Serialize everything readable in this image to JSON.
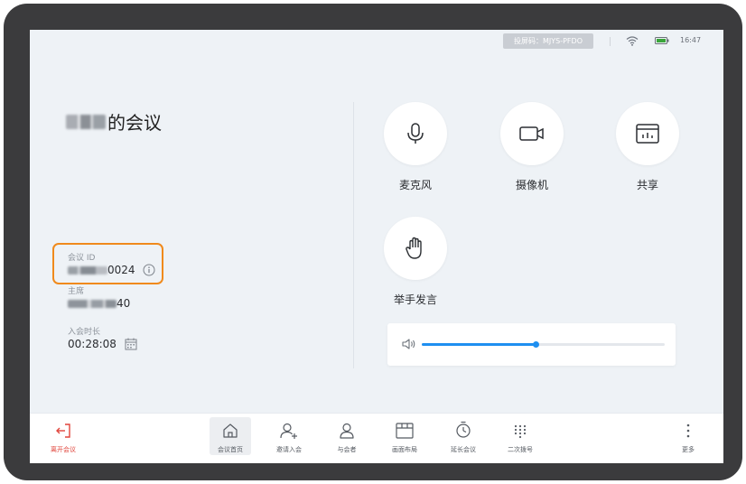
{
  "status_bar": {
    "cast_code": "投屏码：MJYS-PFDO",
    "time": "16:47",
    "wifi_icon": "wifi-icon",
    "battery_icon": "battery-icon"
  },
  "meeting": {
    "title_suffix": "的会议",
    "id_label": "会议 ID",
    "id_value_visible": "0024",
    "host_label": "主席",
    "host_value_visible": "40",
    "duration_label": "入会时长",
    "duration_value": "00:28:08"
  },
  "controls": [
    {
      "label": "麦克风",
      "icon": "microphone-icon"
    },
    {
      "label": "摄像机",
      "icon": "camera-icon"
    },
    {
      "label": "共享",
      "icon": "share-screen-icon"
    },
    {
      "label": "举手发言",
      "icon": "raise-hand-icon"
    }
  ],
  "volume": {
    "icon": "speaker-icon",
    "level": 0.47
  },
  "bottom_bar": {
    "leave_label": "离开会议",
    "tabs": [
      {
        "label": "会议首页",
        "icon": "home-icon",
        "active": true
      },
      {
        "label": "邀请入会",
        "icon": "add-user-icon",
        "active": false
      },
      {
        "label": "与会者",
        "icon": "participants-icon",
        "active": false
      },
      {
        "label": "画面布局",
        "icon": "layout-icon",
        "active": false
      },
      {
        "label": "延长会议",
        "icon": "timer-icon",
        "active": false
      },
      {
        "label": "二次拨号",
        "icon": "dialpad-icon",
        "active": false
      }
    ],
    "more_label": "更多"
  },
  "colors": {
    "accent": "#1e8ff0",
    "leave": "#e0443b",
    "highlight": "#f08a1c"
  }
}
